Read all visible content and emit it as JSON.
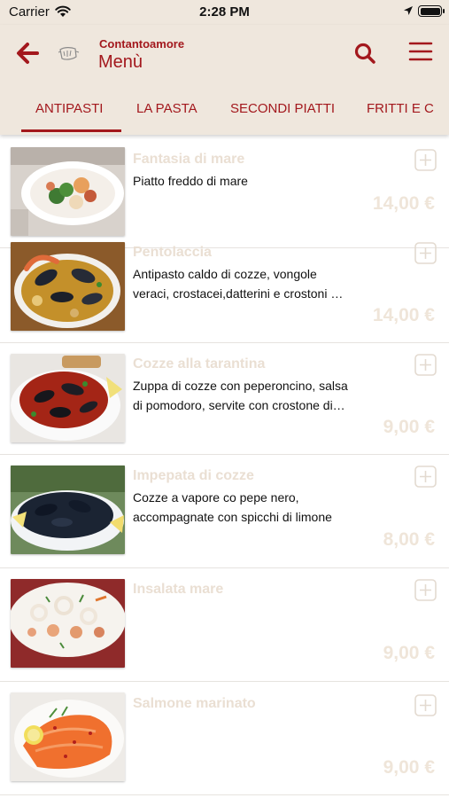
{
  "status_bar": {
    "carrier": "Carrier",
    "time": "2:28 PM"
  },
  "header": {
    "restaurant": "Contantoamore",
    "title": "Menù"
  },
  "tabs": [
    "ANTIPASTI",
    "LA PASTA",
    "SECONDI PIATTI",
    "FRITTI E C"
  ],
  "active_tab": "ANTIPASTI",
  "colors": {
    "accent": "#a3181d",
    "header_bg": "#efe7dd",
    "muted_text": "#eadfd3"
  },
  "items": [
    {
      "name": "Fantasia di mare",
      "desc": [
        "Piatto freddo di mare"
      ],
      "price": "14,00 €",
      "image": "seafood-salad-plate"
    },
    {
      "name": "Pentolaccia",
      "desc": [
        "Antipasto caldo di cozze, vongole",
        "veraci, crostacei,datterini e crostoni …"
      ],
      "price": "14,00 €",
      "image": "shellfish-pot"
    },
    {
      "name": "Cozze alla tarantina",
      "desc": [
        "Zuppa di cozze con peperoncino, salsa",
        "di pomodoro, servite con crostone di…"
      ],
      "price": "9,00 €",
      "image": "mussels-tomato"
    },
    {
      "name": "Impepata di cozze",
      "desc": [
        "Cozze a vapore co pepe nero,",
        "accompagnate con spicchi di limone"
      ],
      "price": "8,00 €",
      "image": "mussels-lemon"
    },
    {
      "name": "Insalata mare",
      "desc": [],
      "price": "9,00 €",
      "image": "seafood-salad-dish"
    },
    {
      "name": "Salmone marinato",
      "desc": [],
      "price": "9,00 €",
      "image": "marinated-salmon"
    }
  ]
}
